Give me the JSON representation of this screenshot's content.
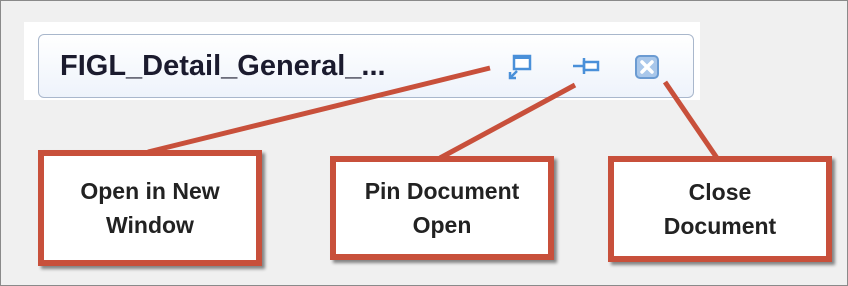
{
  "document_tab": {
    "title": "FIGL_Detail_General_..."
  },
  "icons": {
    "open_new_window": "open-new-window-icon",
    "pin": "pin-icon",
    "close": "close-icon"
  },
  "callouts": {
    "open_new_window": [
      "Open in New",
      "Window"
    ],
    "pin_document": [
      "Pin Document",
      "Open"
    ],
    "close_document": [
      "Close",
      "Document"
    ]
  },
  "colors": {
    "callout_border": "#c8503b",
    "icon_blue": "#4a90d9"
  }
}
